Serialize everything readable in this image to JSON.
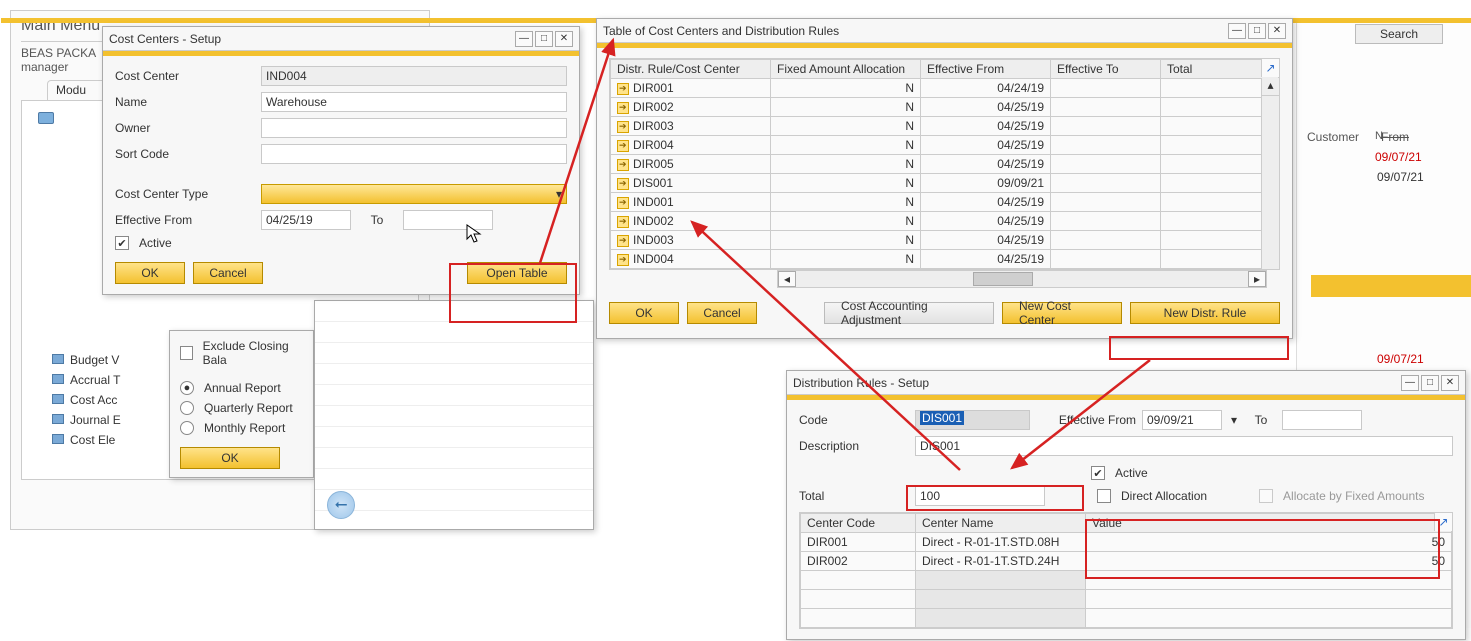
{
  "mainmenu": {
    "title": "Main Menu",
    "pkg": "BEAS PACKA",
    "manager": "manager",
    "tab": "Modu",
    "items": [
      "Budget V",
      "Accrual T",
      "Cost Acc",
      "Journal E",
      "Cost Ele"
    ]
  },
  "subpanel": {
    "exclude": "Exclude Closing Bala",
    "annual": "Annual Report",
    "quarterly": "Quarterly Report",
    "monthly": "Monthly Report",
    "ok": "OK"
  },
  "right": {
    "customer_lbl": "Customer",
    "name_lbl": "Name",
    "from_lbl": "From",
    "date1": "09/07/21",
    "date2": "09/07/21",
    "date3": "09/07/21",
    "search": "Search"
  },
  "ccsetup": {
    "title": "Cost Centers - Setup",
    "lbl_cc": "Cost Center",
    "cc": "IND004",
    "lbl_name": "Name",
    "name": "Warehouse",
    "lbl_owner": "Owner",
    "owner": "",
    "lbl_sort": "Sort Code",
    "sort": "",
    "lbl_type": "Cost Center Type",
    "lbl_eff": "Effective From",
    "eff_from": "04/25/19",
    "lbl_to": "To",
    "eff_to": "",
    "active": "Active",
    "ok": "OK",
    "cancel": "Cancel",
    "open_table": "Open Table"
  },
  "ccsetup_accel": {
    "ok": "O",
    "cancel": "C",
    "open_table": "O"
  },
  "cctable": {
    "title": "Table of Cost Centers and Distribution Rules",
    "hdr_rule": "Distr. Rule/Cost Center",
    "hdr_fixed": "Fixed Amount Allocation",
    "hdr_from": "Effective From",
    "hdr_to": "Effective To",
    "hdr_total": "Total",
    "rows": [
      {
        "code": "DIR001",
        "fixed": "N",
        "from": "04/24/19"
      },
      {
        "code": "DIR002",
        "fixed": "N",
        "from": "04/25/19"
      },
      {
        "code": "DIR003",
        "fixed": "N",
        "from": "04/25/19"
      },
      {
        "code": "DIR004",
        "fixed": "N",
        "from": "04/25/19"
      },
      {
        "code": "DIR005",
        "fixed": "N",
        "from": "04/25/19"
      },
      {
        "code": "DIS001",
        "fixed": "N",
        "from": "09/09/21"
      },
      {
        "code": "IND001",
        "fixed": "N",
        "from": "04/25/19"
      },
      {
        "code": "IND002",
        "fixed": "N",
        "from": "04/25/19"
      },
      {
        "code": "IND003",
        "fixed": "N",
        "from": "04/25/19"
      },
      {
        "code": "IND004",
        "fixed": "N",
        "from": "04/25/19"
      }
    ],
    "ok": "OK",
    "cancel": "Cancel",
    "cost_adj": "Cost Accounting Adjustment",
    "new_cc": "New Cost Center",
    "new_rule": "New Distr. Rule"
  },
  "drsetup": {
    "title": "Distribution Rules - Setup",
    "lbl_code": "Code",
    "code": "DIS001",
    "lbl_eff": "Effective From",
    "eff_from": "09/09/21",
    "lbl_to": "To",
    "eff_to": "",
    "lbl_desc": "Description",
    "desc": "DIS001",
    "active": "Active",
    "direct": "Direct Allocation",
    "allocfixed": "Allocate by Fixed Amounts",
    "lbl_total": "Total",
    "total": "100",
    "hdr_code": "Center Code",
    "hdr_name": "Center Name",
    "hdr_value": "Value",
    "rows": [
      {
        "code": "DIR001",
        "name": "Direct - R-01-1T.STD.08H",
        "value": "50"
      },
      {
        "code": "DIR002",
        "name": "Direct - R-01-1T.STD.24H",
        "value": "50"
      }
    ]
  }
}
